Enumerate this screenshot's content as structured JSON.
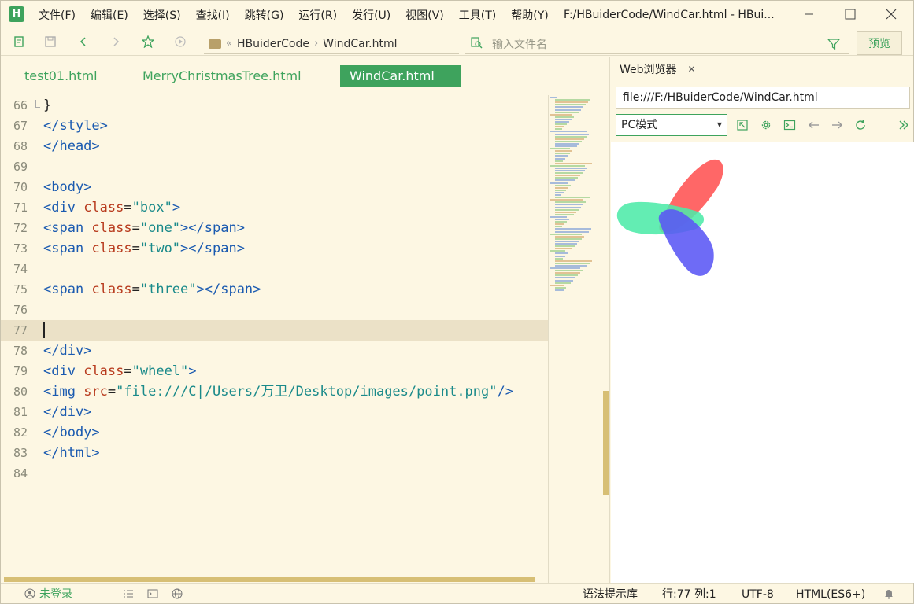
{
  "menu": [
    "文件(F)",
    "编辑(E)",
    "选择(S)",
    "查找(I)",
    "跳转(G)",
    "运行(R)",
    "发行(U)",
    "视图(V)",
    "工具(T)",
    "帮助(Y)"
  ],
  "window_title": "F:/HBuiderCode/WindCar.html - HBui...",
  "toolbar": {
    "breadcrumb": [
      "HBuiderCode",
      "WindCar.html"
    ],
    "search_placeholder": "输入文件名",
    "preview_label": "预览"
  },
  "editor_tabs": [
    "test01.html",
    "MerryChristmasTree.html",
    "WindCar.html"
  ],
  "active_tab": "WindCar.html",
  "code_lines": [
    {
      "n": "66",
      "tokens": [
        {
          "t": "plain",
          "v": "}"
        }
      ]
    },
    {
      "n": "67",
      "tokens": [
        {
          "t": "tag",
          "v": "</style>"
        }
      ]
    },
    {
      "n": "68",
      "tokens": [
        {
          "t": "tag",
          "v": "</head>"
        }
      ]
    },
    {
      "n": "69",
      "tokens": []
    },
    {
      "n": "70",
      "tokens": [
        {
          "t": "tag",
          "v": "<body>"
        }
      ]
    },
    {
      "n": "71",
      "tokens": [
        {
          "t": "tag",
          "v": "<div "
        },
        {
          "t": "attr",
          "v": "class"
        },
        {
          "t": "eq",
          "v": "="
        },
        {
          "t": "str",
          "v": "\"box\""
        },
        {
          "t": "tag",
          "v": ">"
        }
      ]
    },
    {
      "n": "72",
      "tokens": [
        {
          "t": "tag",
          "v": "<span "
        },
        {
          "t": "attr",
          "v": "class"
        },
        {
          "t": "eq",
          "v": "="
        },
        {
          "t": "str",
          "v": "\"one\""
        },
        {
          "t": "tag",
          "v": "></span>"
        }
      ]
    },
    {
      "n": "73",
      "tokens": [
        {
          "t": "tag",
          "v": "<span "
        },
        {
          "t": "attr",
          "v": "class"
        },
        {
          "t": "eq",
          "v": "="
        },
        {
          "t": "str",
          "v": "\"two\""
        },
        {
          "t": "tag",
          "v": "></span>"
        }
      ]
    },
    {
      "n": "74",
      "tokens": []
    },
    {
      "n": "75",
      "tokens": [
        {
          "t": "tag",
          "v": "<span "
        },
        {
          "t": "attr",
          "v": "class"
        },
        {
          "t": "eq",
          "v": "="
        },
        {
          "t": "str",
          "v": "\"three\""
        },
        {
          "t": "tag",
          "v": "></span>"
        }
      ]
    },
    {
      "n": "76",
      "tokens": []
    },
    {
      "n": "77",
      "tokens": [],
      "current": true
    },
    {
      "n": "78",
      "tokens": [
        {
          "t": "tag",
          "v": "</div>"
        }
      ]
    },
    {
      "n": "79",
      "tokens": [
        {
          "t": "tag",
          "v": "<div "
        },
        {
          "t": "attr",
          "v": "class"
        },
        {
          "t": "eq",
          "v": "="
        },
        {
          "t": "str",
          "v": "\"wheel\""
        },
        {
          "t": "tag",
          "v": ">"
        }
      ]
    },
    {
      "n": "80",
      "tokens": [
        {
          "t": "tag",
          "v": "<img "
        },
        {
          "t": "attr",
          "v": "src"
        },
        {
          "t": "eq",
          "v": "="
        },
        {
          "t": "str",
          "v": "\"file:///C|/Users/万卫/Desktop/images/point.png\""
        },
        {
          "t": "tag",
          "v": "/>"
        }
      ]
    },
    {
      "n": "81",
      "tokens": [
        {
          "t": "tag",
          "v": "</div>"
        }
      ]
    },
    {
      "n": "82",
      "tokens": [
        {
          "t": "tag",
          "v": "</body>"
        }
      ]
    },
    {
      "n": "83",
      "tokens": [
        {
          "t": "tag",
          "v": "</html>"
        }
      ]
    },
    {
      "n": "84",
      "tokens": []
    }
  ],
  "browser": {
    "tab_label": "Web浏览器",
    "url": "file:///F:/HBuiderCode/WindCar.html",
    "mode": "PC模式"
  },
  "statusbar": {
    "login": "未登录",
    "syntax": "语法提示库",
    "position": "行:77  列:1",
    "encoding": "UTF-8",
    "language": "HTML(ES6+)"
  },
  "colors": {
    "accent": "#3ea35d",
    "background": "#fdf7e3",
    "tag": "#1a5ab0",
    "attr": "#b83b1e",
    "string": "#1a8a8a",
    "blade_red": "#ff5a5a",
    "blade_green": "#4deaa8",
    "blade_blue": "#5a56f5"
  }
}
